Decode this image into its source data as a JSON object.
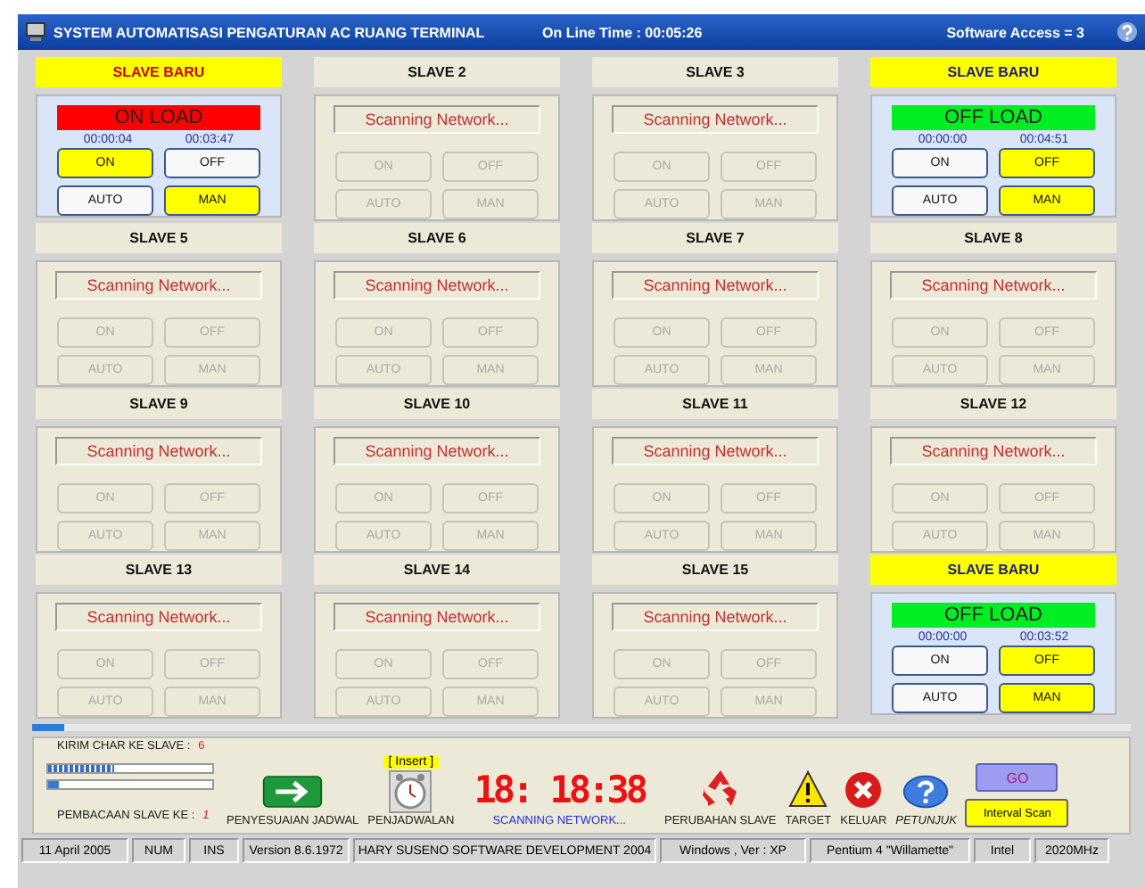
{
  "window": {
    "title": "SYSTEM AUTOMATISASI PENGATURAN AC RUANG TERMINAL",
    "online_time": "On Line Time :  00:05:26",
    "software_access": "Software Access  = 3"
  },
  "slaves": [
    {
      "kind": "active",
      "title": "SLAVE BARU",
      "color": "#cc0000",
      "status": {
        "text": "ON LOAD",
        "color": "#ff0000"
      },
      "time_on": "00:00:04",
      "time_off": "00:03:47",
      "buttons": [
        {
          "label": "ON",
          "selected": true,
          "disabled": false
        },
        {
          "label": "OFF",
          "selected": false,
          "disabled": false
        },
        {
          "label": "AUTO",
          "selected": false,
          "disabled": false
        },
        {
          "label": "MAN",
          "selected": true,
          "disabled": false
        }
      ]
    },
    {
      "kind": "scanning",
      "title": "SLAVE 2",
      "status": {
        "text": "Scanning Network..."
      },
      "buttons": [
        {
          "label": "ON",
          "disabled": true
        },
        {
          "label": "OFF",
          "disabled": true
        },
        {
          "label": "AUTO",
          "disabled": true
        },
        {
          "label": "MAN",
          "disabled": true
        }
      ]
    },
    {
      "kind": "scanning",
      "title": "SLAVE 3",
      "status": {
        "text": "Scanning Network..."
      },
      "buttons": [
        {
          "label": "ON",
          "disabled": true
        },
        {
          "label": "OFF",
          "disabled": true
        },
        {
          "label": "AUTO",
          "disabled": true
        },
        {
          "label": "MAN",
          "disabled": true
        }
      ]
    },
    {
      "kind": "active",
      "title": "SLAVE BARU",
      "color": "#1a1a8c",
      "status": {
        "text": "OFF LOAD",
        "color": "#00ee22"
      },
      "time_on": "00:00:00",
      "time_off": "00:04:51",
      "buttons": [
        {
          "label": "ON",
          "selected": false,
          "disabled": false
        },
        {
          "label": "OFF",
          "selected": true,
          "disabled": false
        },
        {
          "label": "AUTO",
          "selected": false,
          "disabled": false
        },
        {
          "label": "MAN",
          "selected": true,
          "disabled": false
        }
      ]
    },
    {
      "kind": "scanning",
      "title": "SLAVE 5",
      "status": {
        "text": "Scanning Network..."
      },
      "buttons": [
        {
          "label": "ON",
          "disabled": true
        },
        {
          "label": "OFF",
          "disabled": true
        },
        {
          "label": "AUTO",
          "disabled": true
        },
        {
          "label": "MAN",
          "disabled": true
        }
      ]
    },
    {
      "kind": "scanning",
      "title": "SLAVE 6",
      "status": {
        "text": "Scanning Network..."
      },
      "buttons": [
        {
          "label": "ON",
          "disabled": true
        },
        {
          "label": "OFF",
          "disabled": true
        },
        {
          "label": "AUTO",
          "disabled": true
        },
        {
          "label": "MAN",
          "disabled": true
        }
      ]
    },
    {
      "kind": "scanning",
      "title": "SLAVE 7",
      "status": {
        "text": "Scanning Network..."
      },
      "buttons": [
        {
          "label": "ON",
          "disabled": true
        },
        {
          "label": "OFF",
          "disabled": true
        },
        {
          "label": "AUTO",
          "disabled": true
        },
        {
          "label": "MAN",
          "disabled": true
        }
      ]
    },
    {
      "kind": "scanning",
      "title": "SLAVE 8",
      "status": {
        "text": "Scanning Network..."
      },
      "buttons": [
        {
          "label": "ON",
          "disabled": true
        },
        {
          "label": "OFF",
          "disabled": true
        },
        {
          "label": "AUTO",
          "disabled": true
        },
        {
          "label": "MAN",
          "disabled": true
        }
      ]
    },
    {
      "kind": "scanning",
      "title": "SLAVE 9",
      "status": {
        "text": "Scanning Network..."
      },
      "buttons": [
        {
          "label": "ON",
          "disabled": true
        },
        {
          "label": "OFF",
          "disabled": true
        },
        {
          "label": "AUTO",
          "disabled": true
        },
        {
          "label": "MAN",
          "disabled": true
        }
      ]
    },
    {
      "kind": "scanning",
      "title": "SLAVE 10",
      "status": {
        "text": "Scanning Network..."
      },
      "buttons": [
        {
          "label": "ON",
          "disabled": true
        },
        {
          "label": "OFF",
          "disabled": true
        },
        {
          "label": "AUTO",
          "disabled": true
        },
        {
          "label": "MAN",
          "disabled": true
        }
      ]
    },
    {
      "kind": "scanning",
      "title": "SLAVE 11",
      "status": {
        "text": "Scanning Network..."
      },
      "buttons": [
        {
          "label": "ON",
          "disabled": true
        },
        {
          "label": "OFF",
          "disabled": true
        },
        {
          "label": "AUTO",
          "disabled": true
        },
        {
          "label": "MAN",
          "disabled": true
        }
      ]
    },
    {
      "kind": "scanning",
      "title": "SLAVE 12",
      "status": {
        "text": "Scanning Network..."
      },
      "buttons": [
        {
          "label": "ON",
          "disabled": true
        },
        {
          "label": "OFF",
          "disabled": true
        },
        {
          "label": "AUTO",
          "disabled": true
        },
        {
          "label": "MAN",
          "disabled": true
        }
      ]
    },
    {
      "kind": "scanning",
      "title": "SLAVE 13",
      "status": {
        "text": "Scanning Network..."
      },
      "buttons": [
        {
          "label": "ON",
          "disabled": true
        },
        {
          "label": "OFF",
          "disabled": true
        },
        {
          "label": "AUTO",
          "disabled": true
        },
        {
          "label": "MAN",
          "disabled": true
        }
      ]
    },
    {
      "kind": "scanning",
      "title": "SLAVE 14",
      "status": {
        "text": "Scanning Network..."
      },
      "buttons": [
        {
          "label": "ON",
          "disabled": true
        },
        {
          "label": "OFF",
          "disabled": true
        },
        {
          "label": "AUTO",
          "disabled": true
        },
        {
          "label": "MAN",
          "disabled": true
        }
      ]
    },
    {
      "kind": "scanning",
      "title": "SLAVE 15",
      "status": {
        "text": "Scanning Network..."
      },
      "buttons": [
        {
          "label": "ON",
          "disabled": true
        },
        {
          "label": "OFF",
          "disabled": true
        },
        {
          "label": "AUTO",
          "disabled": true
        },
        {
          "label": "MAN",
          "disabled": true
        }
      ]
    },
    {
      "kind": "active",
      "title": "SLAVE BARU",
      "color": "#1a1a8c",
      "status": {
        "text": "OFF LOAD",
        "color": "#00ee22"
      },
      "time_on": "00:00:00",
      "time_off": "00:03:52",
      "buttons": [
        {
          "label": "ON",
          "selected": false,
          "disabled": false
        },
        {
          "label": "OFF",
          "selected": true,
          "disabled": false
        },
        {
          "label": "AUTO",
          "selected": false,
          "disabled": false
        },
        {
          "label": "MAN",
          "selected": true,
          "disabled": false
        }
      ]
    }
  ],
  "scan_progress": {
    "level": 0.03
  },
  "control_panel": {
    "send_label": "KIRIM CHAR KE SLAVE  :",
    "send_value": "6",
    "send_progress": {
      "level": 0.4
    },
    "read_progress": {
      "level": 0.06
    },
    "read_label": "PEMBACAAN SLAVE KE :",
    "read_value": "1",
    "insert_badge": "[ Insert ]",
    "clock": "18: 18:38",
    "clock_status": "SCANNING NETWORK...",
    "tools": [
      {
        "kind": "arrow",
        "label": "PENYESUAIAN JADWAL"
      },
      {
        "kind": "clock",
        "label": "PENJADWALAN"
      },
      {
        "kind": "display"
      },
      {
        "kind": "recycle",
        "label": "PERUBAHAN SLAVE"
      },
      {
        "kind": "warning",
        "label": "TARGET"
      },
      {
        "kind": "exit",
        "label": "KELUAR"
      },
      {
        "kind": "help",
        "label": "PETUNJUK"
      }
    ],
    "go_button": "GO",
    "interval_button": "Interval Scan"
  },
  "status_bar": [
    "11 April 2005",
    "NUM",
    "INS",
    "Version 8.6.1972",
    "HARY SUSENO SOFTWARE DEVELOPMENT 2004",
    "Windows , Ver : XP",
    "Pentium 4 \"Willamette\"",
    "Intel",
    "2020MHz"
  ]
}
